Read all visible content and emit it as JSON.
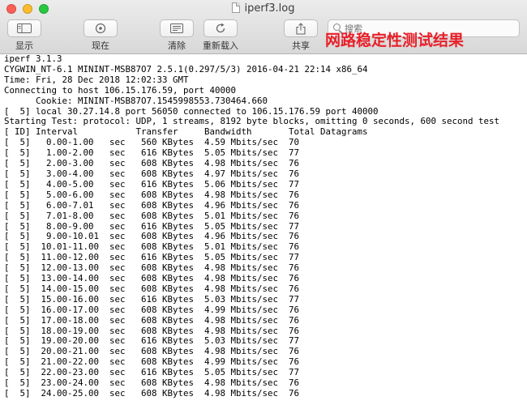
{
  "window": {
    "title": "iperf3.log"
  },
  "toolbar": {
    "display_label": "显示",
    "now_label": "现在",
    "clear_label": "清除",
    "reload_label": "重新载入",
    "share_label": "共享"
  },
  "search": {
    "placeholder": "搜索"
  },
  "overlay": {
    "title": "网路稳定性测试结果"
  },
  "colors": {
    "overlay_text": "#e8202a",
    "close": "#fc5f57",
    "minimize": "#fdbc2e",
    "zoom": "#28c840"
  },
  "log_lines": [
    "iperf 3.1.3",
    "CYGWIN_NT-6.1 MININT-MSB87O7 2.5.1(0.297/5/3) 2016-04-21 22:14 x86_64",
    "Time: Fri, 28 Dec 2018 12:02:33 GMT",
    "Connecting to host 106.15.176.59, port 40000",
    "      Cookie: MININT-MSB87O7.1545998553.730464.660",
    "[  5] local 30.27.14.8 port 56050 connected to 106.15.176.59 port 40000",
    "Starting Test: protocol: UDP, 1 streams, 8192 byte blocks, omitting 0 seconds, 600 second test",
    "[ ID] Interval           Transfer     Bandwidth       Total Datagrams",
    "[  5]   0.00-1.00   sec   560 KBytes  4.59 Mbits/sec  70",
    "[  5]   1.00-2.00   sec   616 KBytes  5.05 Mbits/sec  77",
    "[  5]   2.00-3.00   sec   608 KBytes  4.98 Mbits/sec  76",
    "[  5]   3.00-4.00   sec   608 KBytes  4.97 Mbits/sec  76",
    "[  5]   4.00-5.00   sec   616 KBytes  5.06 Mbits/sec  77",
    "[  5]   5.00-6.00   sec   608 KBytes  4.98 Mbits/sec  76",
    "[  5]   6.00-7.01   sec   608 KBytes  4.96 Mbits/sec  76",
    "[  5]   7.01-8.00   sec   608 KBytes  5.01 Mbits/sec  76",
    "[  5]   8.00-9.00   sec   616 KBytes  5.05 Mbits/sec  77",
    "[  5]   9.00-10.01  sec   608 KBytes  4.96 Mbits/sec  76",
    "[  5]  10.01-11.00  sec   608 KBytes  5.01 Mbits/sec  76",
    "[  5]  11.00-12.00  sec   616 KBytes  5.05 Mbits/sec  77",
    "[  5]  12.00-13.00  sec   608 KBytes  4.98 Mbits/sec  76",
    "[  5]  13.00-14.00  sec   608 KBytes  4.98 Mbits/sec  76",
    "[  5]  14.00-15.00  sec   608 KBytes  4.98 Mbits/sec  76",
    "[  5]  15.00-16.00  sec   616 KBytes  5.03 Mbits/sec  77",
    "[  5]  16.00-17.00  sec   608 KBytes  4.99 Mbits/sec  76",
    "[  5]  17.00-18.00  sec   608 KBytes  4.98 Mbits/sec  76",
    "[  5]  18.00-19.00  sec   608 KBytes  4.98 Mbits/sec  76",
    "[  5]  19.00-20.00  sec   616 KBytes  5.03 Mbits/sec  77",
    "[  5]  20.00-21.00  sec   608 KBytes  4.98 Mbits/sec  76",
    "[  5]  21.00-22.00  sec   608 KBytes  4.99 Mbits/sec  76",
    "[  5]  22.00-23.00  sec   616 KBytes  5.05 Mbits/sec  77",
    "[  5]  23.00-24.00  sec   608 KBytes  4.98 Mbits/sec  76",
    "[  5]  24.00-25.00  sec   608 KBytes  4.98 Mbits/sec  76"
  ]
}
